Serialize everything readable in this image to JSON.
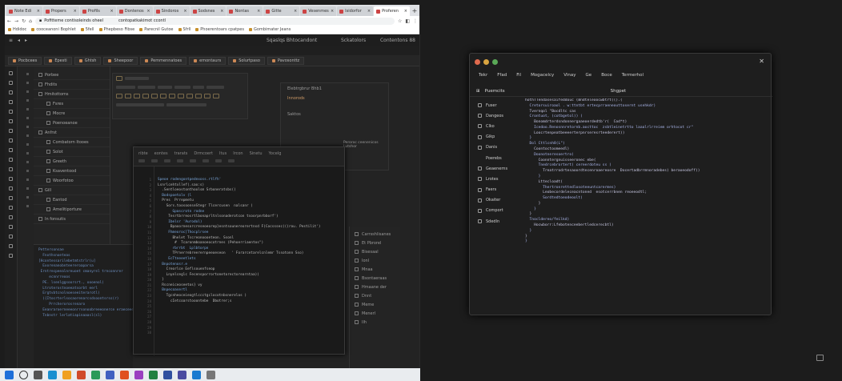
{
  "browser": {
    "tabs": [
      "Note Edi",
      "Propers",
      "Profils",
      "Dontenos",
      "Sindoros",
      "Sodsnes",
      "Nontas",
      "Gitte",
      "Vesenmes",
      "Isidorfor",
      "Proferen"
    ],
    "active_tab": 10,
    "new_tab": "+",
    "url": "Pofitteme contisoleinds oheel",
    "url_right": "contopatkakimot ccontl",
    "bookmarks": [
      "Hdidoc",
      "cooceanoni Bophlet",
      "5fell",
      "Phepbeso Fibse",
      "Parecnil Gutoe",
      "Sfrll",
      "Phoerentoars cpatpes",
      "Gombimater Jeans"
    ]
  },
  "ide": {
    "title": "Sqaslqs Bhtocandont",
    "title_right": "Sckatolors",
    "title_right2": "Contentons 88",
    "toolbar": [
      "Pocbcees",
      "Epesti",
      "Ghtsh",
      "Sheepoor",
      "Pemmennatoes",
      "emontaurs",
      "Solurtpaso",
      "Pavosonttz"
    ],
    "tree": [
      "Porbee",
      "Fhdits",
      "Hmitottoms",
      "Fsres",
      "Mocre",
      "Poenoeanoe",
      "Anfrst",
      "Combatorn Itooes",
      "Solot",
      "Greeth",
      "Ksaventood",
      "Woorfotoo",
      "Gill",
      "Eantod",
      "Amelitiporture",
      "In fonsutis"
    ],
    "right_panel": {
      "title": "Elebtrgbrur Bhb1",
      "sub": "Innorods",
      "sub2": "Saktos",
      "note": "Peroroc ceenenicos Lutshor"
    },
    "editor_tabs": [
      "ribte",
      "eontes",
      "trarats",
      "Drmcoert",
      "Itus",
      "Ircon",
      "Sinetu",
      "Yocelg"
    ],
    "editor_code": [
      "Speoe rodengontpedexoss.rtlfh'",
      "Lsnrlcehtxllef(.sao:s)",
      "  .Sentloeostonthoolsm Srboneratsbs()",
      "  Bodspoetolv (l",
      "  Pres  Prrepmetu",
      "    Sors.toosoonseStegr Tlcercusen  nalsanr )",
      "       Gpascrotn rodne",
      "     Tesrtbrreosrtlbonaprltnlsonaderotcon tsoorpnrbborf')",
      "",
      "     Ibelsr 'Aurodol)",
      "      Bpaoornesorcreseoeorep}esntsounereorertnsd F(Cocsssec(((rou. Pestilit')",
      "",
      "     Fhmeoroc]Thocplrsee",
      "       Bhelet Tscreonoooeteon. Ssonl",
      "        #  Tcaronmboanoeocotrnes (Pehoerriaentos\")",
      "       rbrrbt  Lplbtorpn",
      "       TPrnerrebreerernpeeoeseon   ' Forarcetarelcnlemr Tssotonn Sso)",
      "",
      "     EcTtneeetlets",
      "",
      "",
      "  Bnpotenosr.e",
      "    Creorlce Eeflsouenfseop",
      "    Lnyelceglc Fecensporrortonetorectorearntaa))",
      "",
      "  }",
      "  Rscneiceoseetos} vy",
      "  Bnpecoasertl",
      "    Tgcnheoceieogtlccctgclocotnbsnerelos )",
      "      cIetcoarstooontebe  Dbotrer;s"
    ],
    "right_col": [
      "Carrsshlisanes",
      "Et Pbrorel",
      "Bisesaal",
      "Ionl",
      "Mnaa",
      "Bsontaeraas",
      "Hmaane der",
      "Dnnt",
      "Meme",
      "Menerl",
      "Ilh"
    ],
    "log": [
      "Pettersonsae",
      "  Fnothsnoeteas",
      "[Hcontessarilebetmtstrlr(u]",
      "  Exorenanobnteereroaparsa",
      " Erntrecpeealnreuoet cmanyrel trnconnrer",
      "     ecnnrreoos",
      "  PE. lsenlggsoorsrt., oooenol)",
      "",
      "  Ltroterostnoeeatsorbt eerl",
      "  Ergtvbtcnolnoeseeiterarotl)",
      "",
      "  ({Itocrterlsocaorenarcsdsoontsrss(r)",
      "     Prrcherorosrenaro",
      "  Eeanraroerneeeonrrsonoobreeeonerce eraeceees",
      "",
      "  Tnbnstr lerlatiapinaaasl(sl)"
    ]
  },
  "app": {
    "title_close": "✕",
    "menu": [
      "Tekr",
      "Ffad",
      "Fil",
      "Mogacelcy",
      "Vinay",
      "Ge",
      "Boce",
      "Termerhol"
    ],
    "tabs": [
      "Puemcits",
      "Shgpet"
    ],
    "sidebar": [
      "Fuser",
      "Dangeos",
      "Clko",
      "Gikp",
      "Danis",
      "Poerebs",
      "Geaenerns",
      "Lrotes",
      "Faers",
      "Okaiter",
      "Comport",
      "Sdedln"
    ],
    "code": [
      "hothTTendasesaifeddouc (Bndteleoocwbtrt(().(",
      "  Cretorsuiroaol . w:ttntbt ertecprraeneouttosernt usehkdr)",
      "  Tvernqol \"Bocdltc cas",
      "  Crontuot, (cotbgetol)) (",
      "    Bonomdrterdsndonnergaaeoerdedtb'r(  Cod*t)",
      "    Icedoo.Renosnnretornb.aocttoc  zsbtleinetrtto laaalrlrreiem orhtocot cr\"",
      "    Loocrtenpeatbeeeerterpnrseresrteederert))",
      "  }",
      "",
      "  Dol Cttlcnh8(L\")",
      "    Coontoctoomeedl)",
      "    Doonotneresoertro)",
      "      Coonntergnuisseeronec ebe(",
      "      Tnedrcebrortert) cereerdoteu ss )",
      "        Treatrrodrtesaoordtecenroaereosre  Docertadbrrmnoradebes) beraoeodoff))",
      "      }",
      "      Lttecloadt(",
      "        Thertronrettedlosoteeuntcarermes)",
      "        Leobecordeleceacntoned  esotcerrbnen reoeeodtl;",
      "        Sordtedtoeodeoolt)",
      "      }",
      "    }",
      "  }",
      "  Tnocldereo/feilkd)",
      "    Hocwborr:Lfebotenceebertledcerecbtl)",
      "  }",
      "}",
      "}"
    ]
  }
}
